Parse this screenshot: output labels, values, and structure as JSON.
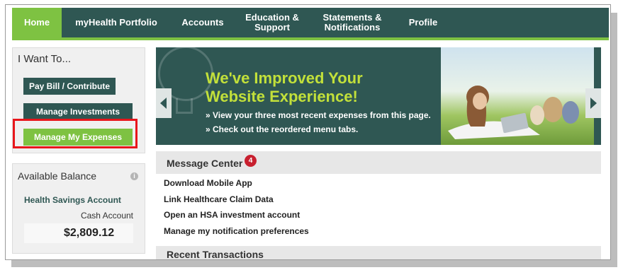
{
  "nav": {
    "items": [
      {
        "label": "Home",
        "active": true
      },
      {
        "label": "myHealth Portfolio",
        "active": false
      },
      {
        "label": "Accounts",
        "active": false
      },
      {
        "label": "Education & Support",
        "active": false
      },
      {
        "label": "Statements & Notifications",
        "active": false
      },
      {
        "label": "Profile",
        "active": false
      }
    ]
  },
  "sidebar": {
    "want_title": "I Want To...",
    "actions": [
      {
        "label": "Pay Bill / Contribute"
      },
      {
        "label": "Manage Investments"
      },
      {
        "label": "Manage My Expenses",
        "highlighted": true
      }
    ],
    "balance": {
      "title": "Available Balance",
      "account_type": "Health Savings Account",
      "sub_account": "Cash Account",
      "amount": "$2,809.12"
    }
  },
  "banner": {
    "headline_1": "We've Improved Your",
    "headline_2": "Website Experience!",
    "bullet_1": "» View your three most recent expenses from this page.",
    "bullet_2": "» Check out the reordered menu tabs."
  },
  "message_center": {
    "title": "Message Center",
    "badge_count": "4",
    "links": [
      {
        "label": "Download Mobile App"
      },
      {
        "label": "Link Healthcare Claim Data"
      },
      {
        "label": "Open an HSA investment account"
      },
      {
        "label": "Manage my notification preferences"
      }
    ]
  },
  "recent_transactions": {
    "title": "Recent Transactions"
  },
  "colors": {
    "primary": "#2f5753",
    "accent": "#7ec242",
    "headline": "#c2e03a",
    "badge": "#c8202f",
    "highlight": "#e8161b"
  },
  "icons": {
    "info": "info-icon",
    "banner_prev": "chevron-left-icon",
    "banner_next": "chevron-right-icon",
    "banner_bulb": "lightbulb-icon"
  }
}
